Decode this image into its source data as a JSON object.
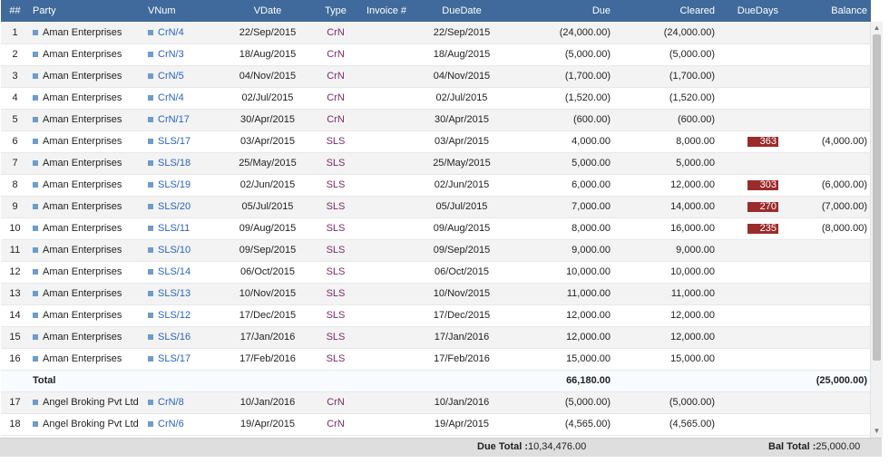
{
  "columns": {
    "idx": "##",
    "party": "Party",
    "vnum": "VNum",
    "vdate": "VDate",
    "type": "Type",
    "invoice": "Invoice #",
    "duedate": "DueDate",
    "due": "Due",
    "cleared": "Cleared",
    "duedays": "DueDays",
    "balance": "Balance"
  },
  "rows": [
    {
      "idx": "1",
      "party": "Aman Enterprises",
      "vnum": "CrN/4",
      "vdate": "22/Sep/2015",
      "type": "CrN",
      "invoice": "",
      "duedate": "22/Sep/2015",
      "due": "(24,000.00)",
      "cleared": "(24,000.00)",
      "duedays": "",
      "balance": ""
    },
    {
      "idx": "2",
      "party": "Aman Enterprises",
      "vnum": "CrN/3",
      "vdate": "18/Aug/2015",
      "type": "CrN",
      "invoice": "",
      "duedate": "18/Aug/2015",
      "due": "(5,000.00)",
      "cleared": "(5,000.00)",
      "duedays": "",
      "balance": ""
    },
    {
      "idx": "3",
      "party": "Aman Enterprises",
      "vnum": "CrN/5",
      "vdate": "04/Nov/2015",
      "type": "CrN",
      "invoice": "",
      "duedate": "04/Nov/2015",
      "due": "(1,700.00)",
      "cleared": "(1,700.00)",
      "duedays": "",
      "balance": ""
    },
    {
      "idx": "4",
      "party": "Aman Enterprises",
      "vnum": "CrN/4",
      "vdate": "02/Jul/2015",
      "type": "CrN",
      "invoice": "",
      "duedate": "02/Jul/2015",
      "due": "(1,520.00)",
      "cleared": "(1,520.00)",
      "duedays": "",
      "balance": ""
    },
    {
      "idx": "5",
      "party": "Aman Enterprises",
      "vnum": "CrN/17",
      "vdate": "30/Apr/2015",
      "type": "CrN",
      "invoice": "",
      "duedate": "30/Apr/2015",
      "due": "(600.00)",
      "cleared": "(600.00)",
      "duedays": "",
      "balance": ""
    },
    {
      "idx": "6",
      "party": "Aman Enterprises",
      "vnum": "SLS/17",
      "vdate": "03/Apr/2015",
      "type": "SLS",
      "invoice": "",
      "duedate": "03/Apr/2015",
      "due": "4,000.00",
      "cleared": "8,000.00",
      "duedays": "363",
      "balance": "(4,000.00)"
    },
    {
      "idx": "7",
      "party": "Aman Enterprises",
      "vnum": "SLS/18",
      "vdate": "25/May/2015",
      "type": "SLS",
      "invoice": "",
      "duedate": "25/May/2015",
      "due": "5,000.00",
      "cleared": "5,000.00",
      "duedays": "",
      "balance": ""
    },
    {
      "idx": "8",
      "party": "Aman Enterprises",
      "vnum": "SLS/19",
      "vdate": "02/Jun/2015",
      "type": "SLS",
      "invoice": "",
      "duedate": "02/Jun/2015",
      "due": "6,000.00",
      "cleared": "12,000.00",
      "duedays": "303",
      "balance": "(6,000.00)"
    },
    {
      "idx": "9",
      "party": "Aman Enterprises",
      "vnum": "SLS/20",
      "vdate": "05/Jul/2015",
      "type": "SLS",
      "invoice": "",
      "duedate": "05/Jul/2015",
      "due": "7,000.00",
      "cleared": "14,000.00",
      "duedays": "270",
      "balance": "(7,000.00)"
    },
    {
      "idx": "10",
      "party": "Aman Enterprises",
      "vnum": "SLS/11",
      "vdate": "09/Aug/2015",
      "type": "SLS",
      "invoice": "",
      "duedate": "09/Aug/2015",
      "due": "8,000.00",
      "cleared": "16,000.00",
      "duedays": "235",
      "balance": "(8,000.00)"
    },
    {
      "idx": "11",
      "party": "Aman Enterprises",
      "vnum": "SLS/10",
      "vdate": "09/Sep/2015",
      "type": "SLS",
      "invoice": "",
      "duedate": "09/Sep/2015",
      "due": "9,000.00",
      "cleared": "9,000.00",
      "duedays": "",
      "balance": ""
    },
    {
      "idx": "12",
      "party": "Aman Enterprises",
      "vnum": "SLS/14",
      "vdate": "06/Oct/2015",
      "type": "SLS",
      "invoice": "",
      "duedate": "06/Oct/2015",
      "due": "10,000.00",
      "cleared": "10,000.00",
      "duedays": "",
      "balance": ""
    },
    {
      "idx": "13",
      "party": "Aman Enterprises",
      "vnum": "SLS/13",
      "vdate": "10/Nov/2015",
      "type": "SLS",
      "invoice": "",
      "duedate": "10/Nov/2015",
      "due": "11,000.00",
      "cleared": "11,000.00",
      "duedays": "",
      "balance": ""
    },
    {
      "idx": "14",
      "party": "Aman Enterprises",
      "vnum": "SLS/12",
      "vdate": "17/Dec/2015",
      "type": "SLS",
      "invoice": "",
      "duedate": "17/Dec/2015",
      "due": "12,000.00",
      "cleared": "12,000.00",
      "duedays": "",
      "balance": ""
    },
    {
      "idx": "15",
      "party": "Aman Enterprises",
      "vnum": "SLS/16",
      "vdate": "17/Jan/2016",
      "type": "SLS",
      "invoice": "",
      "duedate": "17/Jan/2016",
      "due": "12,000.00",
      "cleared": "12,000.00",
      "duedays": "",
      "balance": ""
    },
    {
      "idx": "16",
      "party": "Aman Enterprises",
      "vnum": "SLS/17",
      "vdate": "17/Feb/2016",
      "type": "SLS",
      "invoice": "",
      "duedate": "17/Feb/2016",
      "due": "15,000.00",
      "cleared": "15,000.00",
      "duedays": "",
      "balance": ""
    },
    {
      "total": true,
      "label": "Total",
      "due": "66,180.00",
      "balance": "(25,000.00)"
    },
    {
      "idx": "17",
      "party": "Angel Broking Pvt Ltd",
      "vnum": "CrN/8",
      "vdate": "10/Jan/2016",
      "type": "CrN",
      "invoice": "",
      "duedate": "10/Jan/2016",
      "due": "(5,000.00)",
      "cleared": "(5,000.00)",
      "duedays": "",
      "balance": ""
    },
    {
      "idx": "18",
      "party": "Angel Broking Pvt Ltd",
      "vnum": "CrN/6",
      "vdate": "19/Apr/2015",
      "type": "CrN",
      "invoice": "",
      "duedate": "19/Apr/2015",
      "due": "(4,565.00)",
      "cleared": "(4,565.00)",
      "duedays": "",
      "balance": ""
    }
  ],
  "footer": {
    "due_total_label": "Due Total :",
    "due_total_value": "10,34,476.00",
    "bal_total_label": "Bal Total :",
    "bal_total_value": "25,000.00"
  },
  "colors": {
    "header_bg": "#3f6a9b",
    "badge": "#9b2c2c",
    "link": "#2a64c5",
    "type": "#7a2a6a"
  },
  "icons": {
    "bullet": "square-bullet-icon",
    "scroll_up": "scroll-up-arrow-icon",
    "scroll_down": "scroll-down-arrow-icon"
  }
}
